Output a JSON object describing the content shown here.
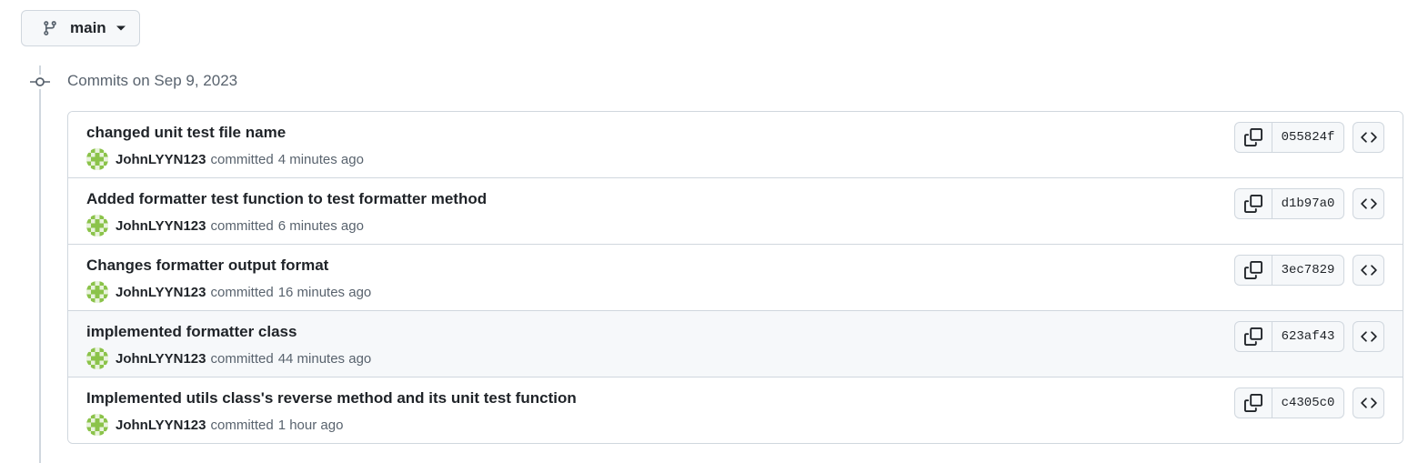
{
  "branch": {
    "name": "main",
    "icon": "git-branch-icon"
  },
  "group": {
    "title": "Commits on Sep 9, 2023"
  },
  "verb": "committed",
  "commits": [
    {
      "message": "changed unit test file name",
      "author": "JohnLYYN123",
      "time": "4 minutes ago",
      "sha": "055824f"
    },
    {
      "message": "Added formatter test function to test formatter method",
      "author": "JohnLYYN123",
      "time": "6 minutes ago",
      "sha": "d1b97a0"
    },
    {
      "message": "Changes formatter output format",
      "author": "JohnLYYN123",
      "time": "16 minutes ago",
      "sha": "3ec7829"
    },
    {
      "message": "implemented formatter class",
      "author": "JohnLYYN123",
      "time": "44 minutes ago",
      "sha": "623af43"
    },
    {
      "message": "Implemented utils class's reverse method and its unit test function",
      "author": "JohnLYYN123",
      "time": "1 hour ago",
      "sha": "c4305c0"
    }
  ],
  "colors": {
    "border": "#d0d7de",
    "muted": "#59636e",
    "text": "#1f2328",
    "avatar_green": "#8bc34a"
  }
}
